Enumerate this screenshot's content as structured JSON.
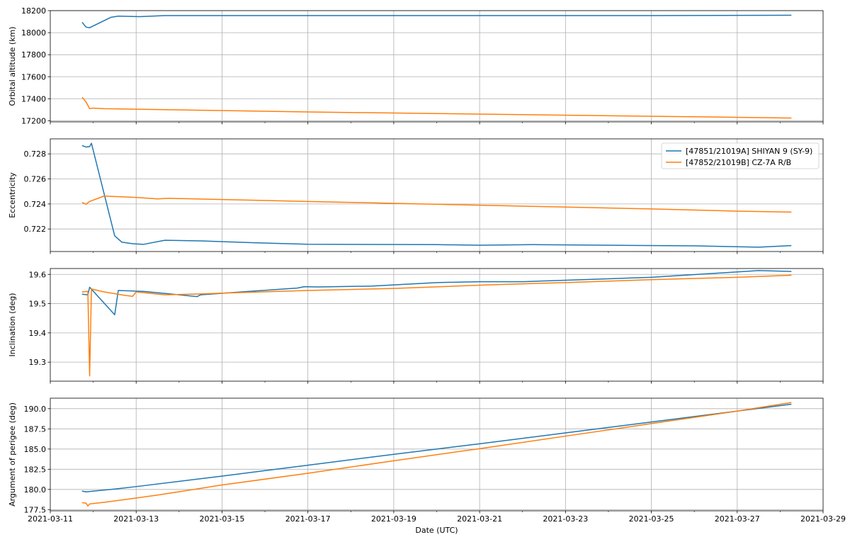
{
  "chart_data": [
    {
      "type": "line",
      "ylabel": "Orbital altitude (km)",
      "ylim": [
        17190,
        18200
      ],
      "yticks": [
        17200,
        17400,
        17600,
        17800,
        18000,
        18200
      ],
      "ytick_labels": [
        "17200",
        "17400",
        "17600",
        "17800",
        "18000",
        "18200"
      ],
      "grid": true,
      "series": [
        {
          "name": "[47851/21019A] SHIYAN 9 (SY-9)",
          "color": "#1f77b4",
          "x": [
            "2021-03-11T18:00",
            "2021-03-11T20:00",
            "2021-03-11T22:00",
            "2021-03-12T10:00",
            "2021-03-12T14:00",
            "2021-03-13T02:00",
            "2021-03-13T16:00",
            "2021-03-15T00:00",
            "2021-03-20T00:00",
            "2021-03-25T00:00",
            "2021-03-28T06:00"
          ],
          "y": [
            18090,
            18050,
            18045,
            18140,
            18150,
            18145,
            18155,
            18155,
            18155,
            18155,
            18158
          ]
        },
        {
          "name": "[47852/21019B] CZ-7A R/B",
          "color": "#ff7f0e",
          "x": [
            "2021-03-11T18:00",
            "2021-03-11T20:00",
            "2021-03-11T22:00",
            "2021-03-12T00:00",
            "2021-03-12T06:00",
            "2021-03-13T00:00",
            "2021-03-17T00:00",
            "2021-03-28T06:00"
          ],
          "y": [
            17410,
            17370,
            17310,
            17315,
            17310,
            17305,
            17280,
            17225
          ]
        }
      ]
    },
    {
      "type": "line",
      "ylabel": "Eccentricity",
      "ylim": [
        0.7202,
        0.7292
      ],
      "yticks": [
        0.722,
        0.724,
        0.726,
        0.728
      ],
      "ytick_labels": [
        "0.722",
        "0.724",
        "0.726",
        "0.728"
      ],
      "grid": true,
      "legend": {
        "placement": "top-right",
        "entries": [
          "[47851/21019A] SHIYAN 9 (SY-9)",
          "[47852/21019B] CZ-7A R/B"
        ]
      },
      "series": [
        {
          "name": "[47851/21019A] SHIYAN 9 (SY-9)",
          "color": "#1f77b4",
          "x": [
            "2021-03-11T18:00",
            "2021-03-11T20:00",
            "2021-03-11T22:00",
            "2021-03-11T23:00",
            "2021-03-12T12:00",
            "2021-03-12T16:00",
            "2021-03-12T22:00",
            "2021-03-13T04:00",
            "2021-03-13T16:00",
            "2021-03-14T12:00",
            "2021-03-15T18:00",
            "2021-03-17T00:00",
            "2021-03-20T00:00",
            "2021-03-21T00:00",
            "2021-03-22T06:00",
            "2021-03-24T00:00",
            "2021-03-26T00:00",
            "2021-03-27T12:00",
            "2021-03-28T06:00"
          ],
          "y": [
            0.72865,
            0.72855,
            0.72858,
            0.72885,
            0.72145,
            0.72095,
            0.72082,
            0.72077,
            0.7211,
            0.72105,
            0.7209,
            0.72078,
            0.72075,
            0.7207,
            0.72075,
            0.7207,
            0.72065,
            0.72055,
            0.72067
          ]
        },
        {
          "name": "[47852/21019B] CZ-7A R/B",
          "color": "#ff7f0e",
          "x": [
            "2021-03-11T18:00",
            "2021-03-11T20:00",
            "2021-03-11T22:00",
            "2021-03-12T06:00",
            "2021-03-13T00:00",
            "2021-03-13T12:00",
            "2021-03-13T18:00",
            "2021-03-15T00:00",
            "2021-03-17T00:00",
            "2021-03-19T00:00",
            "2021-03-21T00:00",
            "2021-03-23T00:00",
            "2021-03-25T00:00",
            "2021-03-27T00:00",
            "2021-03-28T06:00"
          ],
          "y": [
            0.7241,
            0.72398,
            0.7242,
            0.72463,
            0.72452,
            0.7244,
            0.72445,
            0.72435,
            0.7242,
            0.72405,
            0.7239,
            0.72375,
            0.7236,
            0.72343,
            0.72335
          ]
        }
      ]
    },
    {
      "type": "line",
      "ylabel": "Inclination (deg)",
      "ylim": [
        19.235,
        19.62
      ],
      "yticks": [
        19.3,
        19.4,
        19.5,
        19.6
      ],
      "ytick_labels": [
        "19.3",
        "19.4",
        "19.5",
        "19.6"
      ],
      "grid": true,
      "series": [
        {
          "name": "[47851/21019A] SHIYAN 9 (SY-9)",
          "color": "#1f77b4",
          "x": [
            "2021-03-11T18:00",
            "2021-03-11T21:00",
            "2021-03-11T22:00",
            "2021-03-12T12:00",
            "2021-03-12T14:00",
            "2021-03-13T04:00",
            "2021-03-13T16:00",
            "2021-03-14T10:00",
            "2021-03-14T12:00",
            "2021-03-15T18:00",
            "2021-03-16T18:00",
            "2021-03-16T22:00",
            "2021-03-17T06:00",
            "2021-03-18T12:00",
            "2021-03-20T00:00",
            "2021-03-21T00:00",
            "2021-03-22T00:00",
            "2021-03-24T00:00",
            "2021-03-25T00:00",
            "2021-03-27T12:00",
            "2021-03-28T06:00"
          ],
          "y": [
            19.532,
            19.53,
            19.556,
            19.462,
            19.545,
            19.542,
            19.535,
            19.524,
            19.53,
            19.543,
            19.553,
            19.558,
            19.557,
            19.56,
            19.572,
            19.575,
            19.575,
            19.585,
            19.59,
            19.613,
            19.61
          ]
        },
        {
          "name": "[47852/21019B] CZ-7A R/B",
          "color": "#ff7f0e",
          "x": [
            "2021-03-11T18:00",
            "2021-03-11T21:00",
            "2021-03-11T22:00",
            "2021-03-11T23:00",
            "2021-03-12T06:00",
            "2021-03-12T18:00",
            "2021-03-12T22:00",
            "2021-03-13T00:00",
            "2021-03-13T16:00",
            "2021-03-14T12:00",
            "2021-03-15T00:00",
            "2021-03-17T00:00",
            "2021-03-19T00:00",
            "2021-03-21T00:00",
            "2021-03-23T00:00",
            "2021-03-25T00:00",
            "2021-03-27T00:00",
            "2021-03-28T06:00"
          ],
          "y": [
            19.54,
            19.542,
            19.253,
            19.55,
            19.54,
            19.528,
            19.525,
            19.54,
            19.53,
            19.533,
            19.536,
            19.545,
            19.552,
            19.563,
            19.572,
            19.582,
            19.59,
            19.597
          ]
        }
      ]
    },
    {
      "type": "line",
      "ylabel": "Argument of perigee (deg)",
      "ylim": [
        177.35,
        191.3
      ],
      "yticks": [
        177.5,
        180.0,
        182.5,
        185.0,
        187.5,
        190.0
      ],
      "ytick_labels": [
        "177.5",
        "180.0",
        "182.5",
        "185.0",
        "187.5",
        "190.0"
      ],
      "grid": true,
      "series": [
        {
          "name": "[47851/21019A] SHIYAN 9 (SY-9)",
          "color": "#1f77b4",
          "x": [
            "2021-03-11T18:00",
            "2021-03-11T20:00",
            "2021-03-12T12:00",
            "2021-03-13T00:00",
            "2021-03-15T00:00",
            "2021-03-17T00:00",
            "2021-03-19T00:00",
            "2021-03-21T00:00",
            "2021-03-23T00:00",
            "2021-03-25T00:00",
            "2021-03-27T00:00",
            "2021-03-28T06:00"
          ],
          "y": [
            179.78,
            179.7,
            180.05,
            180.35,
            181.65,
            183.0,
            184.35,
            185.65,
            187.0,
            188.35,
            189.7,
            190.55
          ]
        },
        {
          "name": "[47852/21019B] CZ-7A R/B",
          "color": "#ff7f0e",
          "x": [
            "2021-03-11T18:00",
            "2021-03-11T20:00",
            "2021-03-11T21:00",
            "2021-03-11T22:00",
            "2021-03-12T06:00",
            "2021-03-12T18:00",
            "2021-03-13T12:00",
            "2021-03-15T00:00",
            "2021-03-17T00:00",
            "2021-03-19T00:00",
            "2021-03-21T00:00",
            "2021-03-23T00:00",
            "2021-03-25T00:00",
            "2021-03-27T00:00",
            "2021-03-28T06:00"
          ],
          "y": [
            178.35,
            178.3,
            177.95,
            178.2,
            178.4,
            178.75,
            179.3,
            180.55,
            182.0,
            183.55,
            185.05,
            186.6,
            188.15,
            189.7,
            190.75
          ]
        }
      ]
    }
  ],
  "x_axis": {
    "xlabel": "Date (UTC)",
    "xlim": [
      "2021-03-11T00:00",
      "2021-03-29T00:00"
    ],
    "ticks": [
      "2021-03-11",
      "2021-03-13",
      "2021-03-15",
      "2021-03-17",
      "2021-03-19",
      "2021-03-21",
      "2021-03-23",
      "2021-03-25",
      "2021-03-27",
      "2021-03-29"
    ],
    "minor_ticks": [
      "2021-03-12",
      "2021-03-14",
      "2021-03-16",
      "2021-03-18",
      "2021-03-20",
      "2021-03-22",
      "2021-03-24",
      "2021-03-26",
      "2021-03-28"
    ]
  },
  "colors": {
    "series_1": "#1f77b4",
    "series_2": "#ff7f0e",
    "grid": "#b0b0b0",
    "axes": "#000000"
  }
}
